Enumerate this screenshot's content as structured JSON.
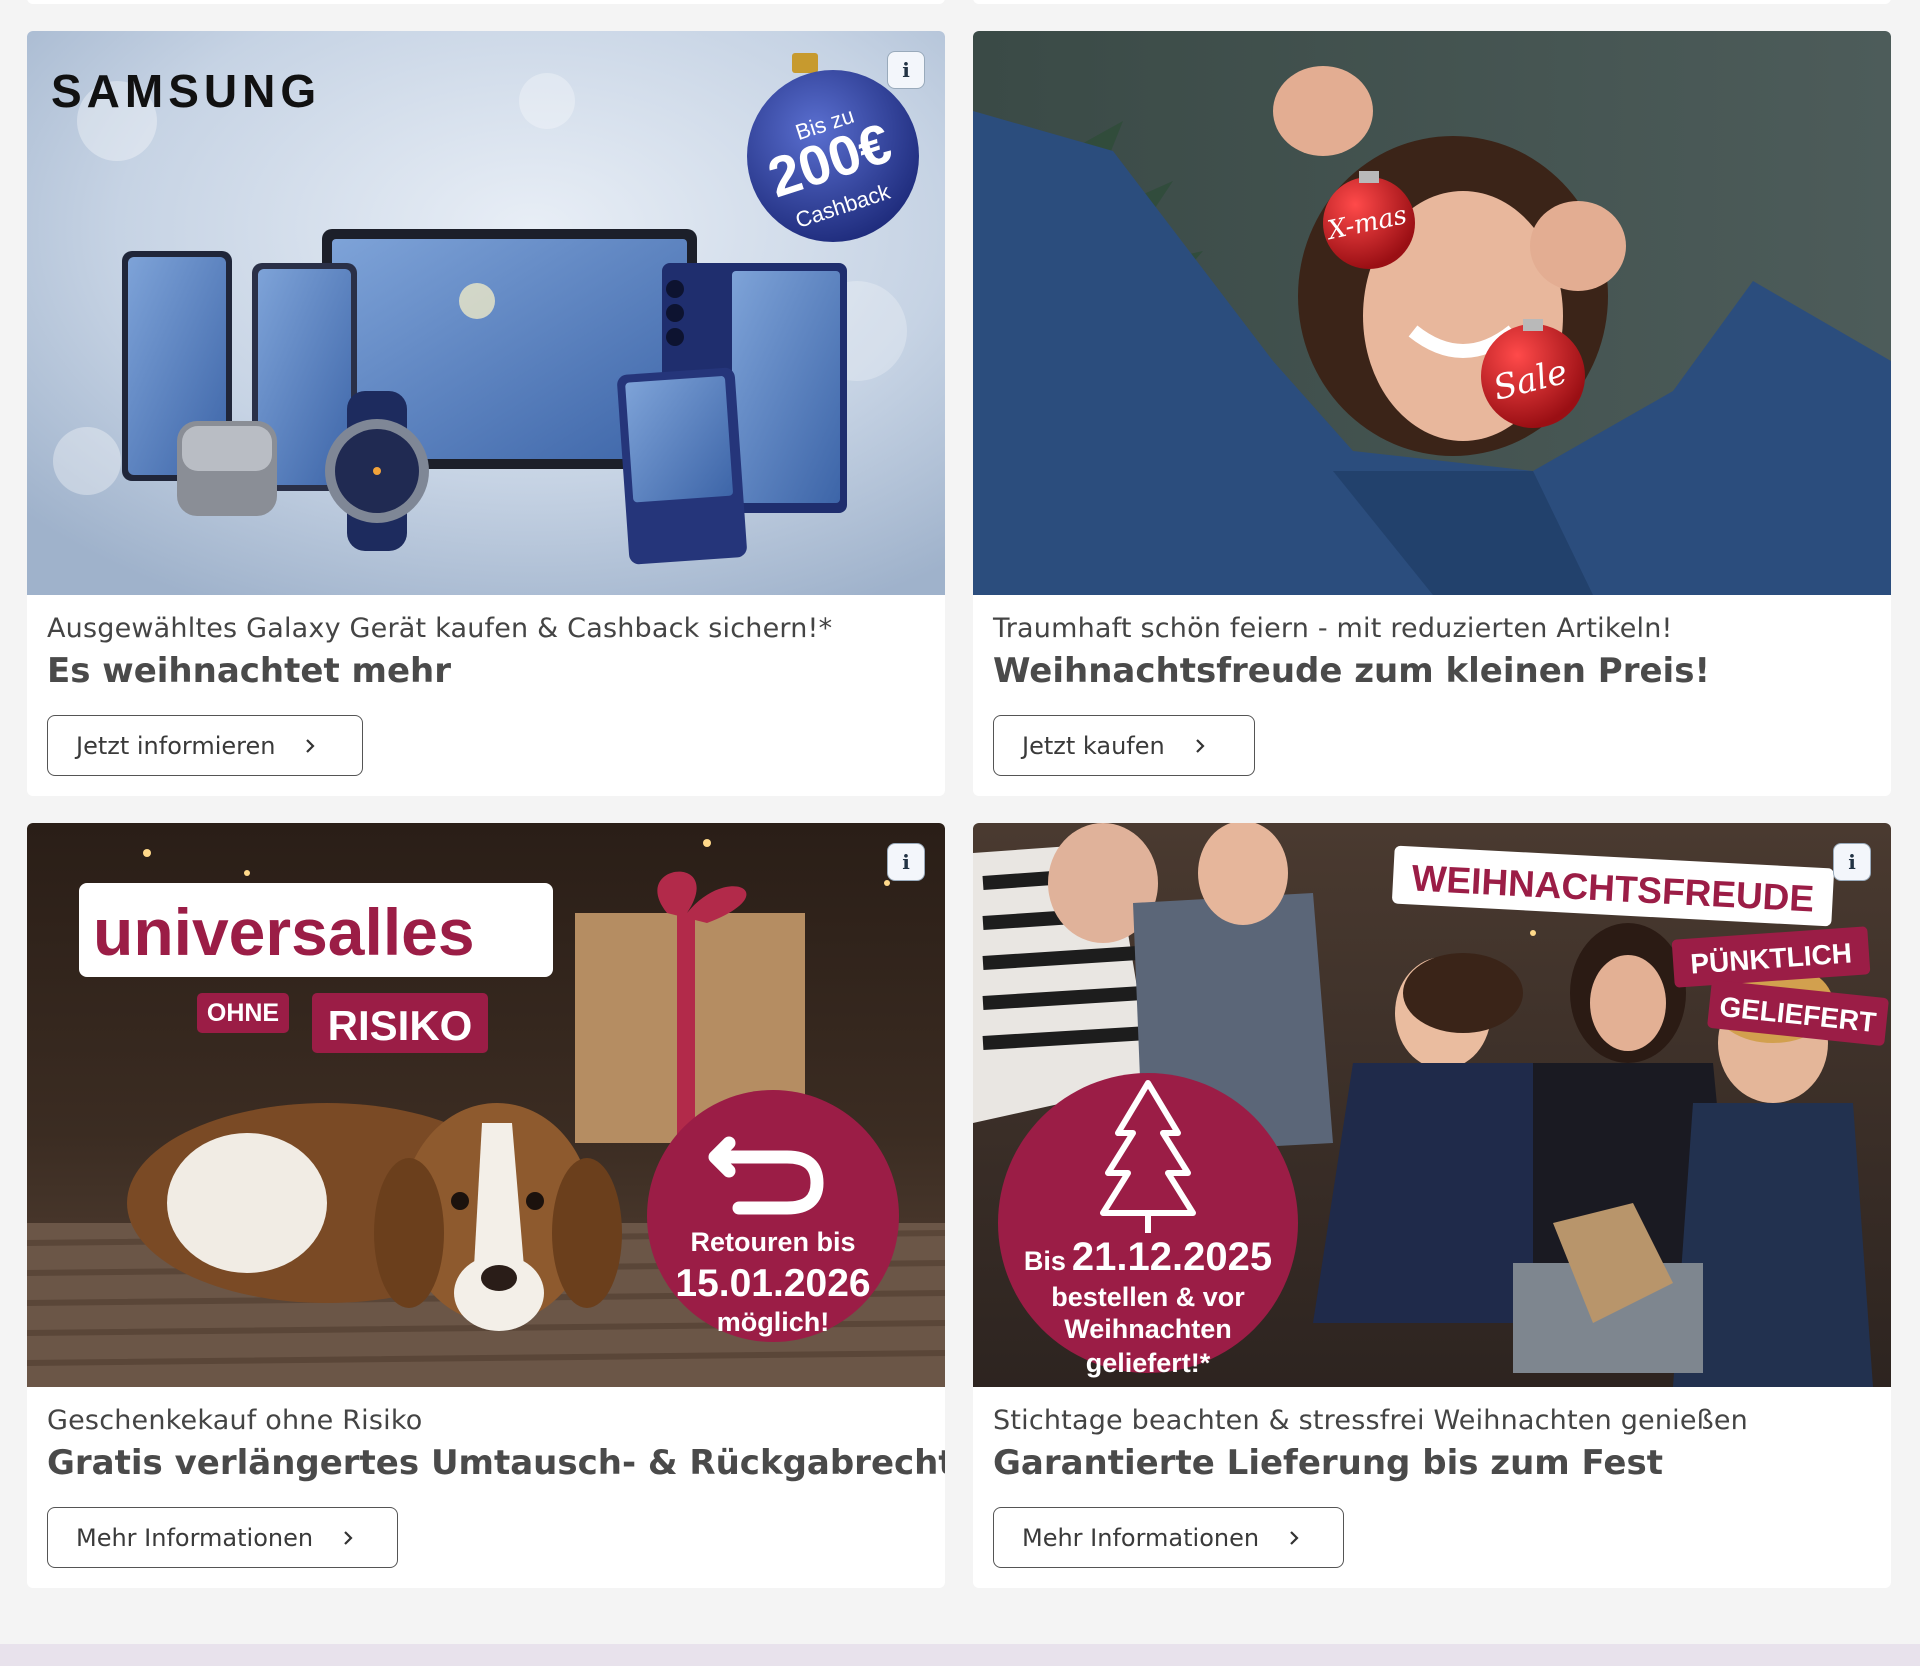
{
  "promos": [
    {
      "subtitle": "Ausgewähltes Galaxy Gerät kaufen & Cashback sichern!*",
      "title": "Es weihnachtet mehr",
      "cta": "Jetzt informieren",
      "image": {
        "brand": "SAMSUNG",
        "badge_line1": "Bis zu",
        "badge_line2": "200€",
        "badge_line3": "Cashback"
      }
    },
    {
      "subtitle": "Traumhaft schön feiern - mit reduzierten Artikeln!",
      "title": "Weihnachtsfreude zum kleinen Preis!",
      "cta": "Jetzt kaufen",
      "image": {
        "ornament1": "X-mas",
        "ornament2": "Sale"
      }
    },
    {
      "subtitle": "Geschenkekauf ohne Risiko",
      "title": "Gratis verlängertes Umtausch- & Rückgabrecht",
      "cta": "Mehr Informationen",
      "image": {
        "brand": "universalles",
        "tag1": "OHNE",
        "tag2": "RISIKO",
        "badge_line1": "Retouren bis",
        "badge_line2": "15.01.2026",
        "badge_line3": "möglich!"
      }
    },
    {
      "subtitle": "Stichtage beachten & stressfrei Weihnachten genießen",
      "title": "Garantierte Lieferung bis zum Fest",
      "cta": "Mehr Informationen",
      "image": {
        "banner": "WEIHNACHTSFREUDE",
        "tag1": "PÜNKTLICH",
        "tag2": "GELIEFERT",
        "badge_line1": "Bis",
        "badge_date": "21.12.2025",
        "badge_line2": "bestellen & vor",
        "badge_line3": "Weihnachten",
        "badge_line4": "geliefert!*"
      }
    }
  ],
  "info_icon": "i",
  "colors": {
    "brand_red": "#9b1d46",
    "text_dark": "#4a4a4a",
    "card_bg": "#ffffff",
    "page_bg": "#f4f4f4"
  }
}
